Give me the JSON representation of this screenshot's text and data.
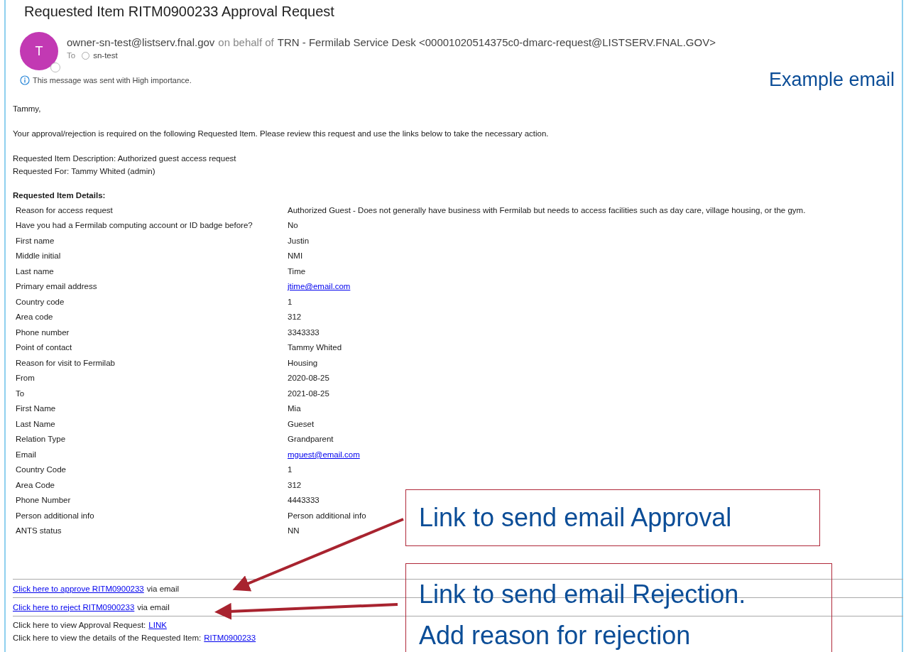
{
  "title": "Requested Item RITM0900233 Approval Request",
  "sender": {
    "avatar_letter": "T",
    "address": "owner-sn-test@listserv.fnal.gov",
    "behalf_text": "on behalf of",
    "name": "TRN - Fermilab Service Desk <00001020514375c0-dmarc-request@LISTSERV.FNAL.GOV>",
    "to_label": "To",
    "recipient": "sn-test"
  },
  "importance_note": "This message was sent with High importance.",
  "greeting": "Tammy,",
  "intro": "Your approval/rejection is required on the following Requested Item. Please review this request and use the links below to take the necessary action.",
  "description": "Requested Item Description: Authorized guest access request",
  "requested_for": "Requested For: Tammy Whited (admin)",
  "details_heading": "Requested Item Details:",
  "details": [
    {
      "label": "Reason for access request",
      "value": "Authorized Guest - Does not generally have business with Fermilab but needs to access facilities such as day care, village housing, or the gym.",
      "kind": "text"
    },
    {
      "label": "Have you had a Fermilab computing account or ID badge before?",
      "value": "No",
      "kind": "text"
    },
    {
      "label": "First name",
      "value": "Justin",
      "kind": "text"
    },
    {
      "label": "Middle initial",
      "value": "NMI",
      "kind": "text"
    },
    {
      "label": "Last name",
      "value": "Time",
      "kind": "text"
    },
    {
      "label": "Primary email address",
      "value": "jtime@email.com",
      "kind": "link"
    },
    {
      "label": "Country code",
      "value": "1",
      "kind": "text"
    },
    {
      "label": "Area code",
      "value": "312",
      "kind": "text"
    },
    {
      "label": "Phone number",
      "value": "3343333",
      "kind": "text"
    },
    {
      "label": "Point of contact",
      "value": "Tammy Whited",
      "kind": "text"
    },
    {
      "label": "Reason for visit to Fermilab",
      "value": "Housing",
      "kind": "text"
    },
    {
      "label": "From",
      "value": "2020-08-25",
      "kind": "text"
    },
    {
      "label": "To",
      "value": "2021-08-25",
      "kind": "text"
    },
    {
      "label": "First Name",
      "value": "Mia",
      "kind": "text"
    },
    {
      "label": "Last Name",
      "value": "Gueset",
      "kind": "text"
    },
    {
      "label": "Relation Type",
      "value": "Grandparent",
      "kind": "text"
    },
    {
      "label": "Email",
      "value": "mguest@email.com",
      "kind": "link"
    },
    {
      "label": "Country Code",
      "value": "1",
      "kind": "text"
    },
    {
      "label": "Area Code",
      "value": "312",
      "kind": "text"
    },
    {
      "label": "Phone Number",
      "value": "4443333",
      "kind": "text"
    },
    {
      "label": "Person additional info",
      "value": "Person additional info",
      "kind": "text"
    },
    {
      "label": "ANTS status",
      "value": "NN",
      "kind": "text"
    }
  ],
  "actions": [
    {
      "link": "Click here to approve RITM0900233",
      "text": "via email"
    },
    {
      "link": "Click here to reject RITM0900233",
      "text": "via email"
    }
  ],
  "view_links": [
    {
      "text": "Click here to view Approval Request:",
      "link": "LINK"
    },
    {
      "text": "Click here to view the details of the Requested Item:",
      "link": "RITM0900233"
    }
  ],
  "annotations": {
    "caption": "Example email",
    "callouts": [
      {
        "lines": [
          "Link to send email Approval"
        ]
      },
      {
        "lines": [
          "Link to send email Rejection.",
          "Add reason for rejection"
        ]
      }
    ]
  }
}
